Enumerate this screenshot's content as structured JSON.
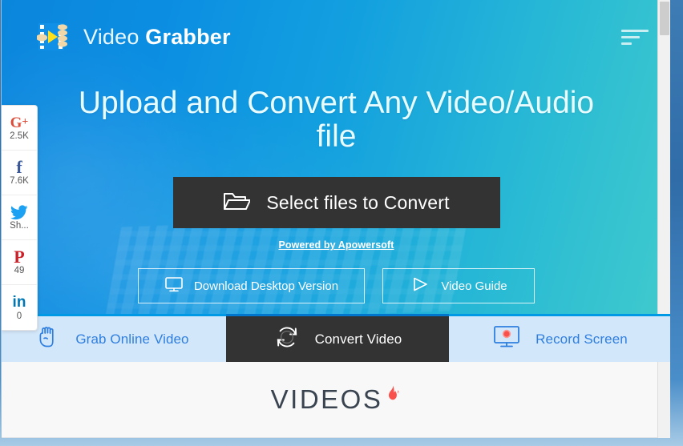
{
  "brand": {
    "name_light": "Video",
    "name_bold": "Grabber",
    "logo_icon": "film-strip-play-icon"
  },
  "header": {
    "menu_icon": "hamburger-menu-icon"
  },
  "hero": {
    "title": "Upload and Convert Any Video/Audio file",
    "cta_label": "Select files to Convert",
    "cta_icon": "open-folder-icon",
    "powered_by": "Powered by Apowersoft",
    "buttons": [
      {
        "label": "Download Desktop Version",
        "icon": "desktop-monitor-icon"
      },
      {
        "label": "Video Guide",
        "icon": "play-triangle-icon"
      }
    ],
    "gradient_from": "#0b86dd",
    "gradient_to": "#40cacd"
  },
  "tabs": [
    {
      "label": "Grab Online Video",
      "icon": "grabbing-hand-icon",
      "active": false
    },
    {
      "label": "Convert Video",
      "icon": "convert-arrows-icon",
      "active": true
    },
    {
      "label": "Record Screen",
      "icon": "monitor-record-icon",
      "active": false
    }
  ],
  "section": {
    "heading": "VIDEOS",
    "badge_icon": "flame-icon",
    "flame_color": "#f9504c"
  },
  "social": [
    {
      "network": "google-plus",
      "glyph": "G+",
      "count": "2.5K",
      "color": "#dd4b39"
    },
    {
      "network": "facebook",
      "glyph": "f",
      "count": "7.6K",
      "color": "#3b5998"
    },
    {
      "network": "twitter",
      "glyph": "bird",
      "count": "Sh...",
      "color": "#1da1f2"
    },
    {
      "network": "pinterest",
      "glyph": "P",
      "count": "49",
      "color": "#cb2027"
    },
    {
      "network": "linkedin",
      "glyph": "in",
      "count": "0",
      "color": "#0077b5"
    }
  ],
  "scrollbar": {
    "position": "top"
  }
}
